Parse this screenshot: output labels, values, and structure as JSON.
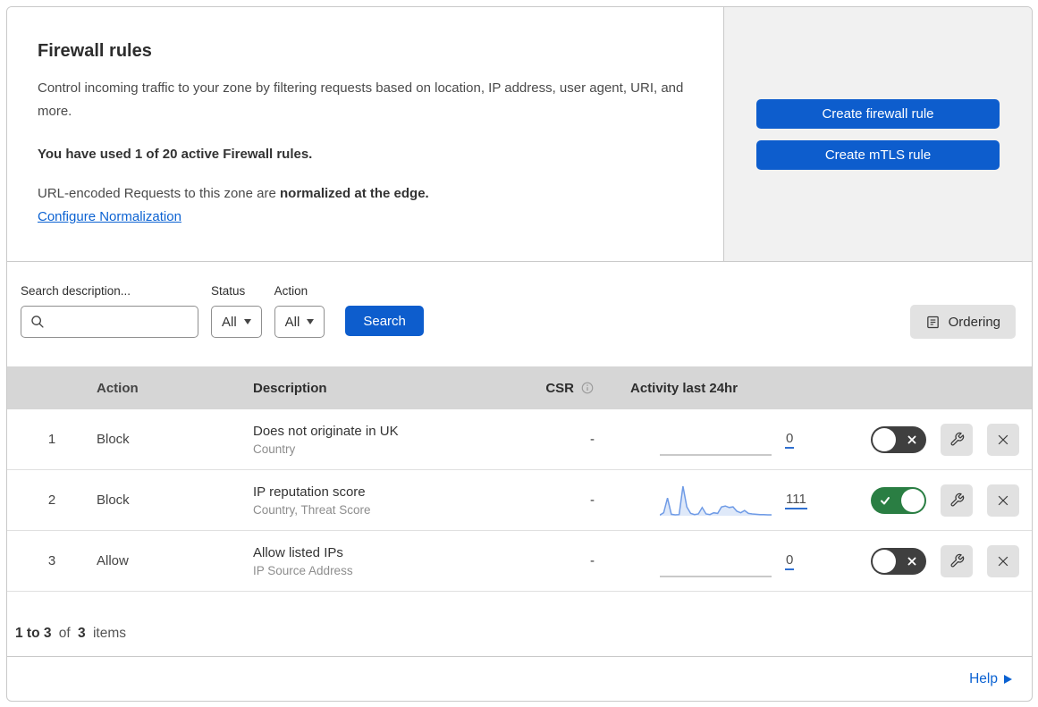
{
  "panel": {
    "title": "Firewall rules",
    "description": "Control incoming traffic to your zone by filtering requests based on location, IP address, user agent, URI, and more.",
    "usage": "You have used 1 of 20 active Firewall rules.",
    "normalization_prefix": "URL-encoded Requests to this zone are",
    "normalization_bold": "normalized at the edge.",
    "normalization_link": "Configure Normalization",
    "buttons": {
      "create_firewall": "Create firewall rule",
      "create_mtls": "Create mTLS rule"
    }
  },
  "filters": {
    "search_label": "Search description...",
    "search_value": "",
    "status": {
      "label": "Status",
      "value": "All"
    },
    "action": {
      "label": "Action",
      "value": "All"
    },
    "search_button": "Search",
    "ordering_button": "Ordering"
  },
  "table": {
    "columns": {
      "action": "Action",
      "description": "Description",
      "csr": "CSR",
      "activity": "Activity last 24hr"
    },
    "rows": [
      {
        "number": "1",
        "action": "Block",
        "description": "Does not originate in UK",
        "fields": "Country",
        "csr": "-",
        "activity_count": "0",
        "enabled": false,
        "sparkline": [
          0,
          0,
          0,
          0,
          0,
          0,
          0,
          0,
          0,
          0,
          0,
          0,
          0,
          0,
          0,
          0,
          0,
          0,
          0,
          0
        ]
      },
      {
        "number": "2",
        "action": "Block",
        "description": "IP reputation score",
        "fields": "Country, Threat Score",
        "csr": "-",
        "activity_count": "111",
        "enabled": true,
        "sparkline": [
          2,
          10,
          60,
          5,
          3,
          4,
          100,
          30,
          8,
          4,
          6,
          28,
          6,
          4,
          10,
          8,
          30,
          33,
          28,
          30,
          15,
          10,
          18,
          8,
          6,
          5,
          4,
          4,
          3,
          3
        ]
      },
      {
        "number": "3",
        "action": "Allow",
        "description": "Allow listed IPs",
        "fields": "IP Source Address",
        "csr": "-",
        "activity_count": "0",
        "enabled": false,
        "sparkline": [
          0,
          0,
          0,
          0,
          0,
          0,
          0,
          0,
          0,
          0,
          0,
          0,
          0,
          0,
          0,
          0,
          0,
          0,
          0,
          0
        ]
      }
    ]
  },
  "footer": {
    "range": "1 to 3",
    "of": "of",
    "total": "3",
    "items": "items"
  },
  "help": {
    "label": "Help"
  },
  "icons": {
    "search_field": "search-icon",
    "csr_header": "info-icon",
    "ordering_button": "list-icon",
    "toggle_on": "check-icon",
    "toggle_off": "x-icon",
    "row_edit": "wrench-icon",
    "row_delete": "x-icon",
    "help": "chevron-right-icon"
  },
  "colors": {
    "accent_blue": "#0d5dcd",
    "link_blue": "#0b62d2",
    "toggle_on_green": "#2a7e43",
    "toggle_off_gray": "#3f3f3f",
    "sparkline_blue": "#6f9be6",
    "sparkline_fill": "#dfe9f9",
    "table_header_bg": "#d6d6d6",
    "side_panel_bg": "#f1f1f1"
  }
}
